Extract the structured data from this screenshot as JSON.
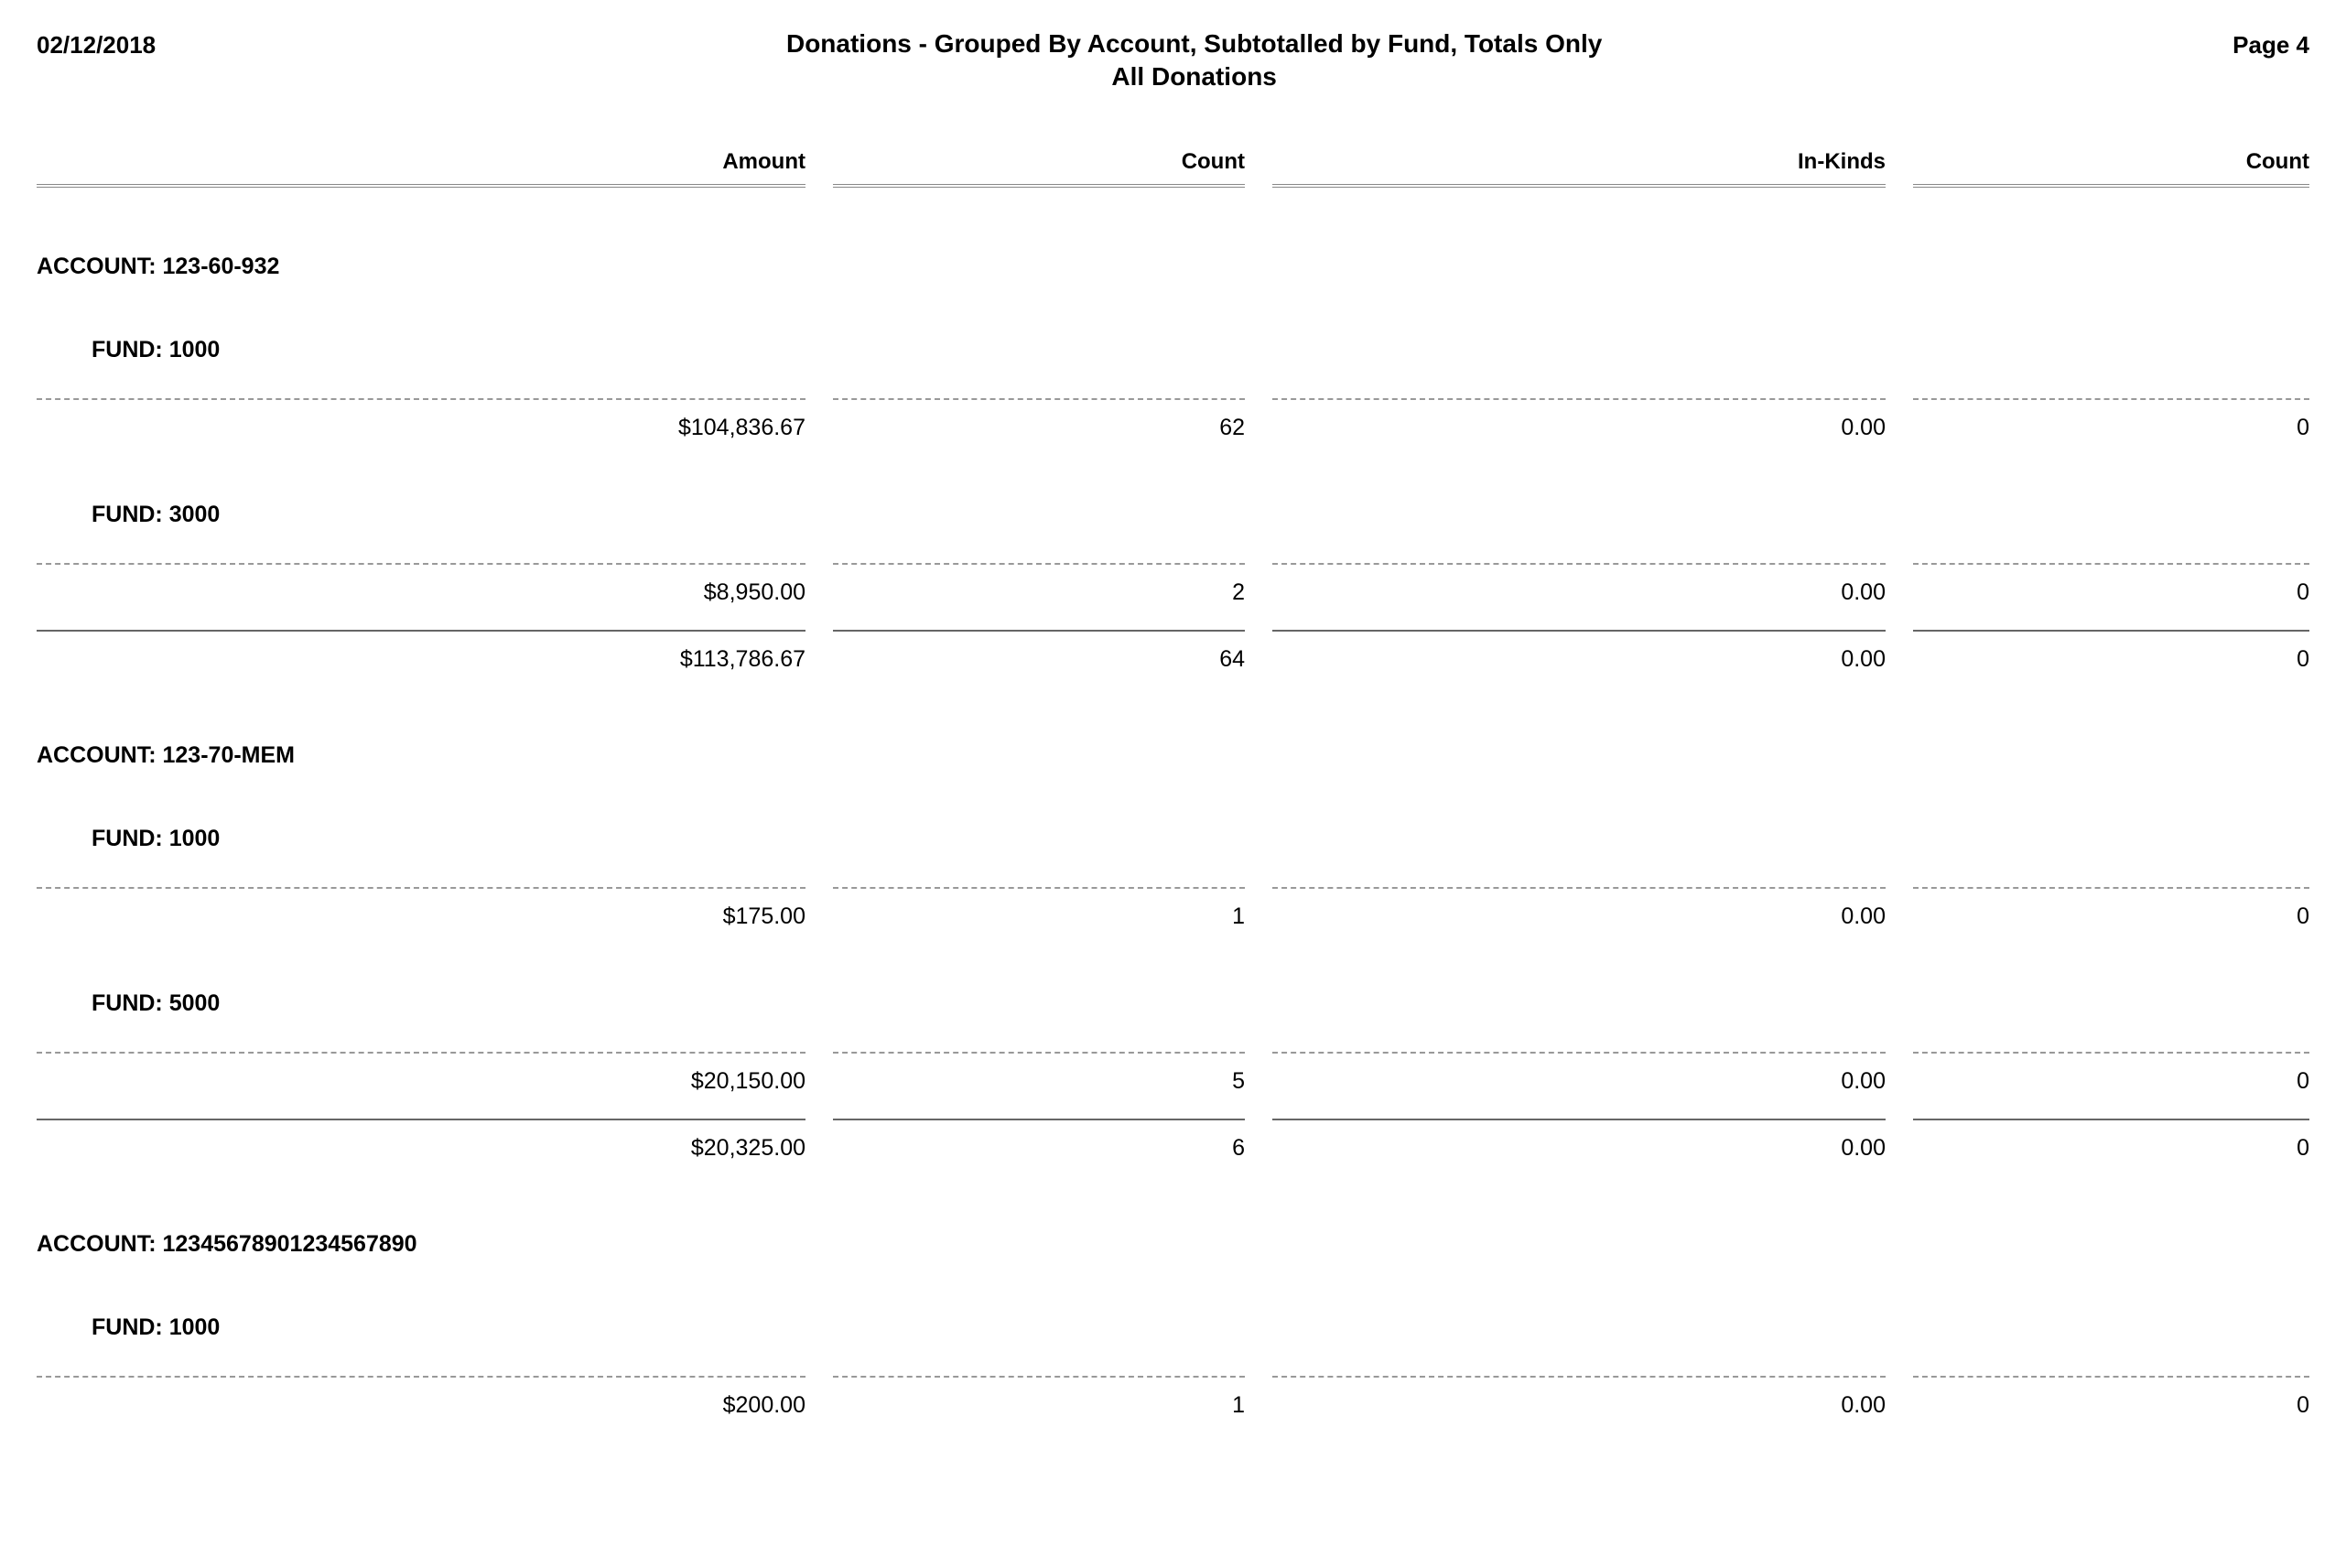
{
  "header": {
    "date": "02/12/2018",
    "title": "Donations - Grouped By Account, Subtotalled by Fund, Totals Only",
    "subtitle": "All Donations",
    "page_label": "Page 4"
  },
  "columns": {
    "amount": "Amount",
    "count1": "Count",
    "inkinds": "In-Kinds",
    "count2": "Count"
  },
  "labels": {
    "account_prefix": "ACCOUNT: ",
    "fund_prefix": "FUND: "
  },
  "accounts": [
    {
      "id": "123-60-932",
      "funds": [
        {
          "id": "1000",
          "amount": "$104,836.67",
          "count1": "62",
          "inkinds": "0.00",
          "count2": "0"
        },
        {
          "id": "3000",
          "amount": "$8,950.00",
          "count1": "2",
          "inkinds": "0.00",
          "count2": "0"
        }
      ],
      "total": {
        "amount": "$113,786.67",
        "count1": "64",
        "inkinds": "0.00",
        "count2": "0"
      }
    },
    {
      "id": "123-70-MEM",
      "funds": [
        {
          "id": "1000",
          "amount": "$175.00",
          "count1": "1",
          "inkinds": "0.00",
          "count2": "0"
        },
        {
          "id": "5000",
          "amount": "$20,150.00",
          "count1": "5",
          "inkinds": "0.00",
          "count2": "0"
        }
      ],
      "total": {
        "amount": "$20,325.00",
        "count1": "6",
        "inkinds": "0.00",
        "count2": "0"
      }
    },
    {
      "id": "12345678901234567890",
      "funds": [
        {
          "id": "1000",
          "amount": "$200.00",
          "count1": "1",
          "inkinds": "0.00",
          "count2": "0"
        }
      ],
      "total": null
    }
  ]
}
